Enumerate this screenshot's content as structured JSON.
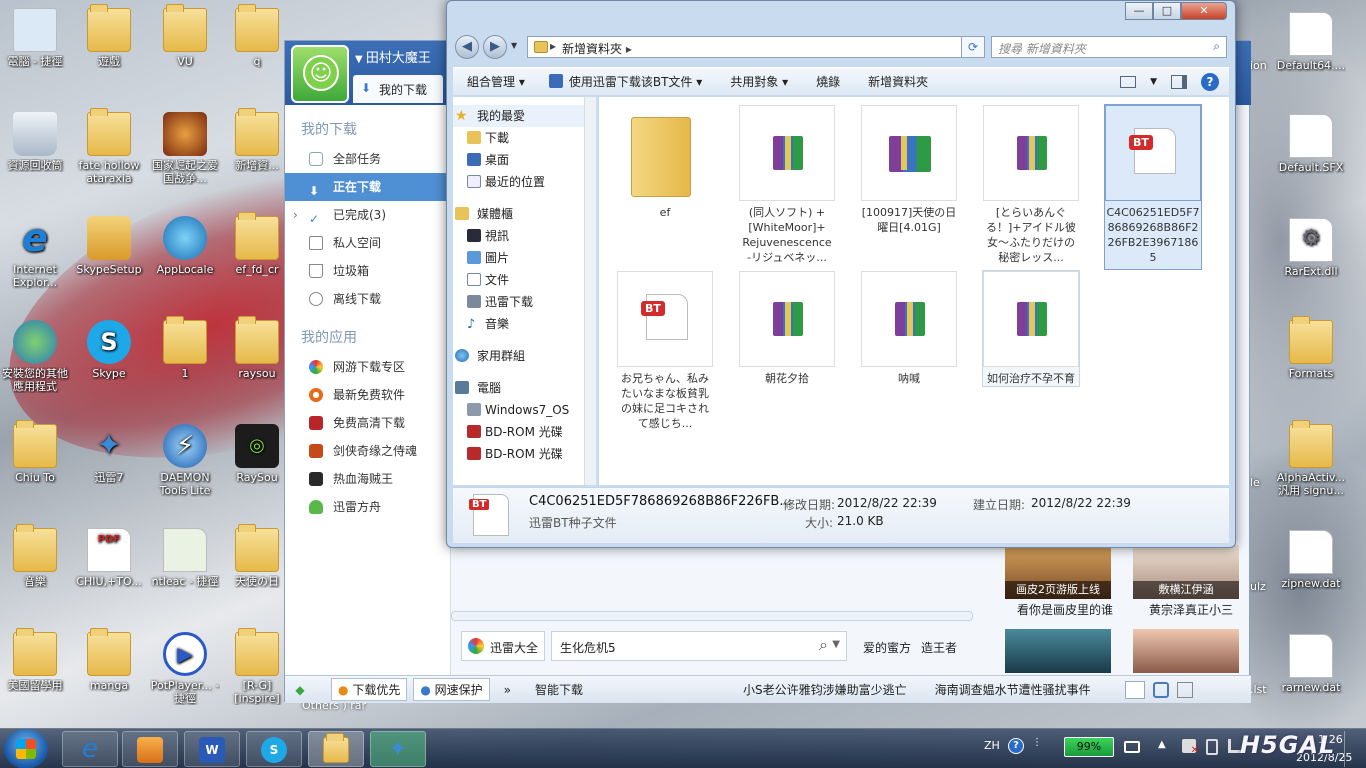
{
  "desktop": {
    "icons": [
      {
        "label": "電腦 - 捷徑"
      },
      {
        "label": "遊戲"
      },
      {
        "label": "VU"
      },
      {
        "label": "q"
      },
      {
        "label": "資源回收筒"
      },
      {
        "label": "fate hollow ataraxia"
      },
      {
        "label": "国家崛起之爱国战争..."
      },
      {
        "label": "新增資..."
      },
      {
        "label": "Internet Explor..."
      },
      {
        "label": "SkypeSetup"
      },
      {
        "label": "AppLocale"
      },
      {
        "label": "ef_fd_cr"
      },
      {
        "label": "安裝您的其他應用程式"
      },
      {
        "label": "Skype"
      },
      {
        "label": "1"
      },
      {
        "label": "raysou"
      },
      {
        "label": "Chiu To"
      },
      {
        "label": "迅雷7"
      },
      {
        "label": "DAEMON Tools Lite"
      },
      {
        "label": "RaySou"
      },
      {
        "label": "音樂"
      },
      {
        "label": "CHIU,+TO..."
      },
      {
        "label": "ntleac - 捷徑"
      },
      {
        "label": "天使の日"
      },
      {
        "label": "美國留學用"
      },
      {
        "label": "manga"
      },
      {
        "label": "PotPlayer... - 捷徑"
      },
      {
        "label": "[R-G] [inspire]"
      },
      {
        "label": "Default64...."
      },
      {
        "label": "Default.SFX"
      },
      {
        "label": "RarExt.dll"
      },
      {
        "label": "Formats"
      },
      {
        "label": "AlphaActiv... 汎用 signu..."
      },
      {
        "label": "zipnew.dat"
      },
      {
        "label": "rarnew.dat"
      },
      {
        "label": "Others ) rar"
      },
      {
        "label": "ion"
      },
      {
        "label": "ulz"
      },
      {
        "label": ".lst"
      },
      {
        "label": "le"
      }
    ]
  },
  "explorer": {
    "window_controls": {
      "minimize": "—",
      "maximize": "□",
      "close": "✕"
    },
    "address": {
      "path": "新增資料夾",
      "separator": "▸"
    },
    "search_placeholder": "搜尋 新增資料夾",
    "commands": [
      "組合管理 ▾",
      "使用迅雷下载该BT文件 ▾",
      "共用對象 ▾",
      "燒錄",
      "新增資料夾"
    ],
    "nav": {
      "favorites": "我的最愛",
      "fav_items": [
        "下載",
        "桌面",
        "最近的位置"
      ],
      "libraries": "媒體櫃",
      "lib_items": [
        "視訊",
        "圖片",
        "文件",
        "迅雷下载",
        "音樂"
      ],
      "homegroup": "家用群組",
      "computer": "電腦",
      "comp_items": [
        "Windows7_OS",
        "BD-ROM 光碟",
        "BD-ROM 光碟"
      ]
    },
    "files": [
      {
        "name": "ef",
        "type": "folder"
      },
      {
        "name": "(同人ソフト) +[WhiteMoor]+ Rejuvenescence -リジュベネッ...",
        "type": "rar"
      },
      {
        "name": "[100917]天使の日曜日[4.01G]",
        "type": "rar"
      },
      {
        "name": "[とらいあんぐる！]+アイドル彼女～ふたりだけの秘密レッス...",
        "type": "rar"
      },
      {
        "name": "C4C06251ED5F786869268B86F226FB2E39671865",
        "type": "bt"
      },
      {
        "name": "お兄ちゃん、私みたいなまな板貧乳の妹に足コキされて感じち...",
        "type": "bt"
      },
      {
        "name": "朝花夕拾",
        "type": "rar"
      },
      {
        "name": "呐喊",
        "type": "rar"
      },
      {
        "name": "如何治疗不孕不育",
        "type": "rar"
      }
    ],
    "details": {
      "name": "C4C06251ED5F786869268B86F226FB...",
      "filetype": "迅雷BT种子文件",
      "modified_label": "修改日期:",
      "modified": "2012/8/22 22:39",
      "size_label": "大小:",
      "size": "21.0 KB",
      "created_label": "建立日期:",
      "created": "2012/8/22 22:39"
    }
  },
  "thunder": {
    "user": "田村大魔王",
    "my_download_tab": "我的下载",
    "section1": "我的下载",
    "items1": [
      "全部任务",
      "正在下载",
      "已完成(3)",
      "私人空间",
      "垃圾箱",
      "离线下载"
    ],
    "section2": "我的应用",
    "items2": [
      "网游下载专区",
      "最新免费软件",
      "免费高清下载",
      "剑侠奇缘之侍魂",
      "热血海贼王",
      "迅雷方舟"
    ],
    "search_btn": "迅雷大全",
    "search_value": "生化危机5",
    "links": [
      "爱的蜜方",
      "造王者"
    ],
    "thumbs": [
      {
        "title": "画皮2页游版上线",
        "caption": "看你是画皮里的谁"
      },
      {
        "title": "敷横江伊涵",
        "caption": "黄宗泽真正小三"
      }
    ],
    "bottom": {
      "priority": "下载优先",
      "protect": "网速保护",
      "more": "»",
      "smart": "智能下载",
      "news1": "小S老公许雅钧涉嫌助富少逃亡",
      "news2": "海南调查媪水节遭性骚扰事件"
    }
  },
  "taskbar": {
    "lang": "ZH",
    "battery": "99%",
    "time": "1:26",
    "date": "2012/8/25",
    "watermark": "H5GAL"
  }
}
